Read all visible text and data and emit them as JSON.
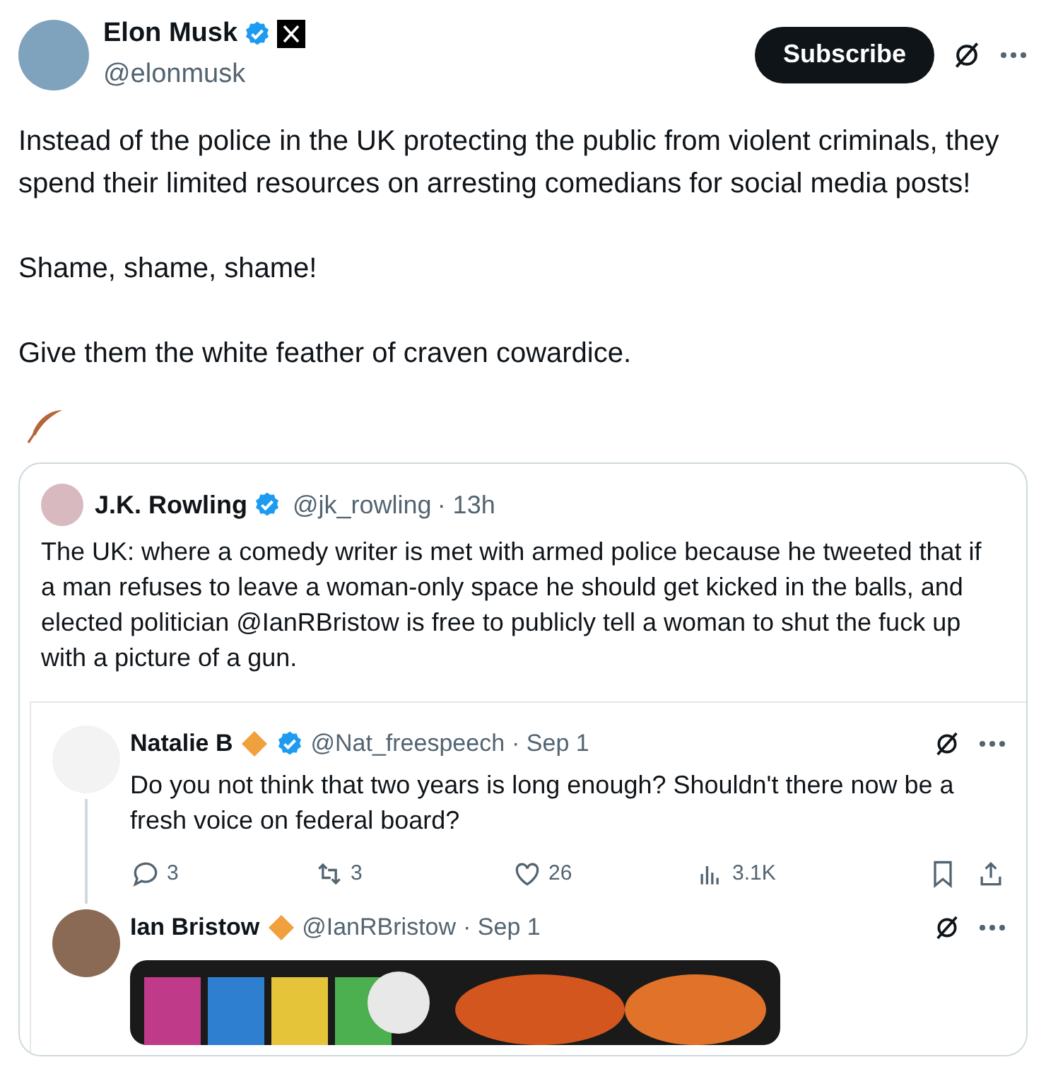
{
  "author": {
    "name": "Elon Musk",
    "handle": "@elonmusk",
    "verified": true
  },
  "subscribe_button": "Subscribe",
  "paragraphs": [
    "Instead of the police in the UK protecting the public from violent criminals, they spend their limited resources on arresting comedians for social media posts!",
    "Shame, shame, shame!",
    "Give them the white feather of craven cowardice."
  ],
  "quoted_post": {
    "name": "J.K. Rowling",
    "handle": "@jk_rowling",
    "time": "· 13h",
    "verified": true,
    "text": "The UK: where a comedy writer is met with armed police because he tweeted that if a man refuses to leave a woman-only space he should get kicked in the balls, and elected politician @IanRBristow is free to publicly tell a woman to shut the fuck up with a picture of a gun.",
    "screenshot_posts": [
      {
        "name": "Natalie B",
        "handle": "@Nat_freespeech",
        "time": "· Sep 1",
        "kind": "reply",
        "verified": true,
        "text": "Do you not think that two years is long enough? Shouldn't there now be a fresh voice on federal board?",
        "replies": "3",
        "reposts": "3",
        "likes": "26",
        "views": "3.1K"
      },
      {
        "name": "Ian Bristow",
        "handle": "@IanRBristow",
        "time": "· Sep 1",
        "kind": "image_post",
        "verified": false
      }
    ]
  }
}
